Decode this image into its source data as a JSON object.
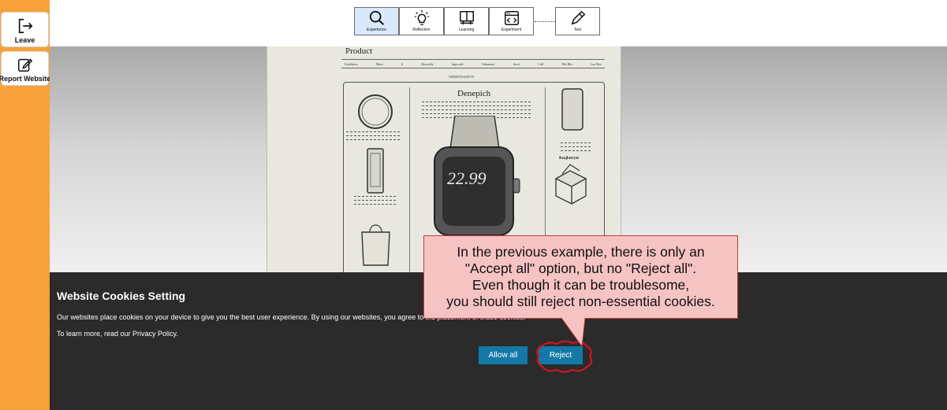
{
  "sidebar": {
    "leave_label": "Leave",
    "report_label": "Report Website",
    "color": "#f7a13a"
  },
  "toolbar": {
    "tools": [
      {
        "label": "Experience",
        "icon": "magnifier-icon",
        "active": true
      },
      {
        "label": "Reflection",
        "icon": "lightbulb-icon",
        "active": false
      },
      {
        "label": "Learning",
        "icon": "book-icon",
        "active": false
      },
      {
        "label": "Experiment",
        "icon": "browser-code-icon",
        "active": false
      },
      {
        "label": "Test",
        "icon": "pencil-icon",
        "active": false
      }
    ],
    "active_color": "#d9e8fb"
  },
  "product_page": {
    "title": "Product",
    "heading": "Denepich",
    "side_heading": "Reajbetryte",
    "nav_items": [
      "Ksukhtore",
      "Maos",
      "tl",
      "Bsmoetly",
      "Ingosatle",
      "Cabunnud",
      "Anoe",
      "Calf",
      "Mis Bhs",
      "Lus Hrsi"
    ],
    "subnav": "WEBSITESLRETE",
    "watch_display": "22.99"
  },
  "cookie_banner": {
    "title": "Website Cookies Setting",
    "text": "Our websites place cookies on your device to give you the best user experience. By using our websites, you agree to the placement of these cookies.",
    "privacy_text": "To learn more, read our Privacy Policy.",
    "allow_label": "Allow all",
    "reject_label": "Reject",
    "background": "#2b2b2b",
    "button_color": "#1479a6"
  },
  "callout": {
    "text": "In the previous example, there is only an\n\"Accept all\" option, but no \"Reject all\".\nEven though it can be troublesome,\nyou should still reject non-essential cookies.",
    "background": "#f6c3c3",
    "border": "#c23b3b"
  },
  "highlight_color": "#d0141f"
}
